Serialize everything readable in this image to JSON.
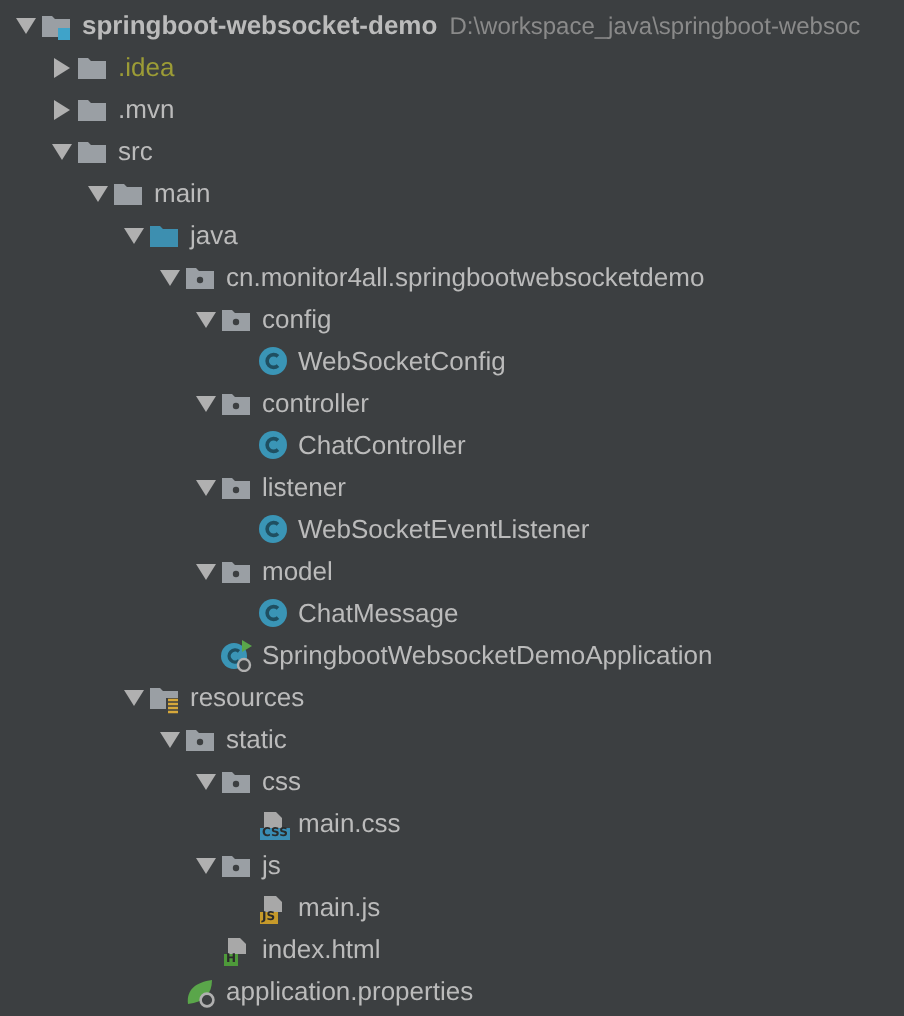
{
  "project_tree": [
    {
      "name": "springboot-websocket-demo",
      "kind": "module",
      "path": "D:\\workspace_java\\springboot-websoc",
      "expanded": true,
      "children": [
        {
          "name": ".idea",
          "kind": "folder",
          "expanded": false,
          "ignored": true
        },
        {
          "name": ".mvn",
          "kind": "folder",
          "expanded": false
        },
        {
          "name": "src",
          "kind": "folder",
          "expanded": true,
          "children": [
            {
              "name": "main",
              "kind": "folder",
              "expanded": true,
              "children": [
                {
                  "name": "java",
                  "kind": "source-folder",
                  "expanded": true,
                  "children": [
                    {
                      "name": "cn.monitor4all.springbootwebsocketdemo",
                      "kind": "package",
                      "expanded": true,
                      "children": [
                        {
                          "name": "config",
                          "kind": "package",
                          "expanded": true,
                          "children": [
                            {
                              "name": "WebSocketConfig",
                              "kind": "class"
                            }
                          ]
                        },
                        {
                          "name": "controller",
                          "kind": "package",
                          "expanded": true,
                          "children": [
                            {
                              "name": "ChatController",
                              "kind": "class"
                            }
                          ]
                        },
                        {
                          "name": "listener",
                          "kind": "package",
                          "expanded": true,
                          "children": [
                            {
                              "name": "WebSocketEventListener",
                              "kind": "class"
                            }
                          ]
                        },
                        {
                          "name": "model",
                          "kind": "package",
                          "expanded": true,
                          "children": [
                            {
                              "name": "ChatMessage",
                              "kind": "class"
                            }
                          ]
                        },
                        {
                          "name": "SpringbootWebsocketDemoApplication",
                          "kind": "app-class"
                        }
                      ]
                    }
                  ]
                },
                {
                  "name": "resources",
                  "kind": "resources-folder",
                  "expanded": true,
                  "children": [
                    {
                      "name": "static",
                      "kind": "package",
                      "expanded": true,
                      "children": [
                        {
                          "name": "css",
                          "kind": "package",
                          "expanded": true,
                          "children": [
                            {
                              "name": "main.css",
                              "kind": "file",
                              "badge": "CSS",
                              "color": "#3a8db5"
                            }
                          ]
                        },
                        {
                          "name": "js",
                          "kind": "package",
                          "expanded": true,
                          "children": [
                            {
                              "name": "main.js",
                              "kind": "file",
                              "badge": "JS",
                              "color": "#c79a2a"
                            }
                          ]
                        },
                        {
                          "name": "index.html",
                          "kind": "file",
                          "badge": "H",
                          "color": "#4e9a3a"
                        }
                      ]
                    },
                    {
                      "name": "application.properties",
                      "kind": "properties"
                    }
                  ]
                }
              ]
            }
          ]
        }
      ]
    }
  ]
}
